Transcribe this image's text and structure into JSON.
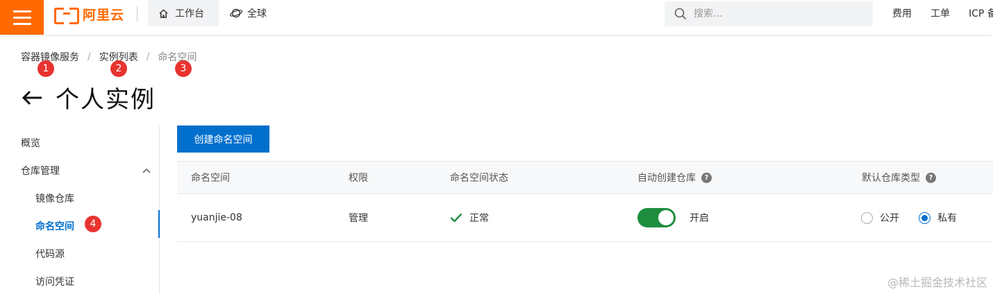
{
  "topbar": {
    "logo_text": "阿里云",
    "workbench_label": "工作台",
    "region_label": "全球",
    "search_placeholder": "搜索...",
    "nav": [
      "费用",
      "工单",
      "ICP 备"
    ]
  },
  "breadcrumb": {
    "items": [
      "容器镜像服务",
      "实例列表",
      "命名空间"
    ],
    "separator": "/"
  },
  "annotations": [
    "1",
    "2",
    "3",
    "4"
  ],
  "page": {
    "title": "个人实例"
  },
  "sidebar": {
    "overview": "概览",
    "repo_management": "仓库管理",
    "sub_items": [
      "镜像仓库",
      "命名空间",
      "代码源",
      "访问凭证"
    ],
    "active_item": "命名空间"
  },
  "main": {
    "create_button": "创建命名空间",
    "table": {
      "headers": [
        "命名空间",
        "权限",
        "命名空间状态",
        "自动创建仓库",
        "默认仓库类型"
      ],
      "rows": [
        {
          "namespace": "yuanjie-08",
          "permission": "管理",
          "status": "正常",
          "auto_create": true,
          "auto_create_label": "开启",
          "repo_type_options": [
            "公开",
            "私有"
          ],
          "repo_type_selected": "私有"
        }
      ]
    }
  },
  "watermark": "@稀土掘金技术社区",
  "colors": {
    "brand_orange": "#ff6a00",
    "primary_blue": "#0070cc",
    "toggle_green": "#1e8e3e",
    "badge_red": "#e8332f",
    "status_ok_green": "#1e8e3e"
  }
}
